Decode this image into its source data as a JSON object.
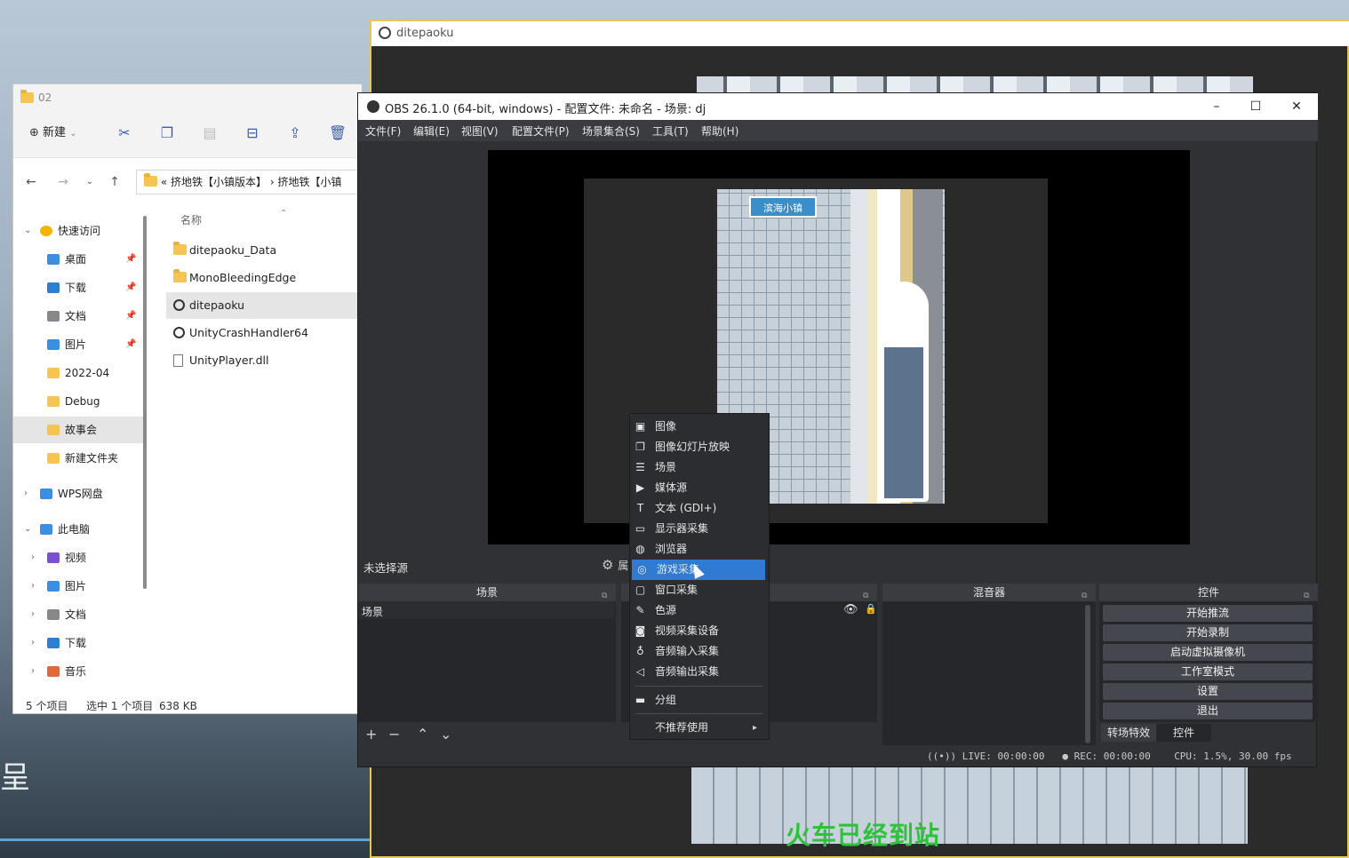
{
  "desktop": {
    "partial_text": "呈"
  },
  "game_window": {
    "title": "ditepaoku",
    "subtitle": "火车已经到站"
  },
  "explorer": {
    "title": "02",
    "toolbar": {
      "new_label": "新建"
    },
    "address": [
      "«",
      "挤地铁【小镇版本】",
      "›",
      "挤地铁【小镇"
    ],
    "sidebar": [
      {
        "label": "快速访问",
        "icon": "star-icon",
        "pinned": false,
        "expander": "⌄"
      },
      {
        "label": "桌面",
        "icon": "desktop-icon",
        "pinned": true
      },
      {
        "label": "下载",
        "icon": "download-icon",
        "pinned": true
      },
      {
        "label": "文档",
        "icon": "document-icon",
        "pinned": true
      },
      {
        "label": "图片",
        "icon": "picture-icon",
        "pinned": true
      },
      {
        "label": "2022-04",
        "icon": "folder-icon",
        "pinned": false
      },
      {
        "label": "Debug",
        "icon": "folder-icon",
        "pinned": false
      },
      {
        "label": "故事会",
        "icon": "folder-icon",
        "pinned": false
      },
      {
        "label": "新建文件夹",
        "icon": "folder-icon",
        "pinned": false
      },
      {
        "label": "WPS网盘",
        "icon": "cloud-icon",
        "pinned": false,
        "expander": "›"
      },
      {
        "label": "此电脑",
        "icon": "computer-icon",
        "pinned": false,
        "expander": "⌄"
      },
      {
        "label": "视频",
        "icon": "video-icon",
        "pinned": false,
        "expander": "›"
      },
      {
        "label": "图片",
        "icon": "picture-icon",
        "pinned": false,
        "expander": "›"
      },
      {
        "label": "文档",
        "icon": "document-icon",
        "pinned": false,
        "expander": "›"
      },
      {
        "label": "下载",
        "icon": "download-icon",
        "pinned": false,
        "expander": "›"
      },
      {
        "label": "音乐",
        "icon": "music-icon",
        "pinned": false,
        "expander": "›"
      }
    ],
    "column_header": "名称",
    "files": [
      {
        "name": "ditepaoku_Data",
        "type": "folder"
      },
      {
        "name": "MonoBleedingEdge",
        "type": "folder"
      },
      {
        "name": "ditepaoku",
        "type": "unity"
      },
      {
        "name": "UnityCrashHandler64",
        "type": "unity"
      },
      {
        "name": "UnityPlayer.dll",
        "type": "dll"
      }
    ],
    "status": {
      "count": "5 个项目",
      "selected": "选中 1 个项目",
      "size": "638 KB"
    }
  },
  "obs": {
    "title": "OBS 26.1.0 (64-bit, windows) - 配置文件: 未命名 - 场景: dj",
    "menu": [
      "文件(F)",
      "编辑(E)",
      "视图(V)",
      "配置文件(P)",
      "场景集合(S)",
      "工具(T)",
      "帮助(H)"
    ],
    "preview": {
      "sign_text": "滨海小镇"
    },
    "no_source": "未选择源",
    "props_label": "属",
    "docks": {
      "scenes": "场景",
      "mixer": "混音器",
      "controls": "控件"
    },
    "scenes": [
      "场景"
    ],
    "controls": [
      "开始推流",
      "开始录制",
      "启动虚拟摄像机",
      "工作室模式",
      "设置",
      "退出"
    ],
    "tabs": [
      "转场特效",
      "控件"
    ],
    "status": {
      "live": "LIVE: 00:00:00",
      "rec": "REC: 00:00:00",
      "cpu": "CPU: 1.5%, 30.00 fps"
    }
  },
  "context_menu": {
    "items": [
      {
        "label": "图像",
        "icon": "image-icon",
        "glyph": "▣"
      },
      {
        "label": "图像幻灯片放映",
        "icon": "slideshow-icon",
        "glyph": "❐"
      },
      {
        "label": "场景",
        "icon": "list-icon",
        "glyph": "☰"
      },
      {
        "label": "媒体源",
        "icon": "play-icon",
        "glyph": "▶"
      },
      {
        "label": "文本 (GDI+)",
        "icon": "text-icon",
        "glyph": "T"
      },
      {
        "label": "显示器采集",
        "icon": "monitor-icon",
        "glyph": "▭"
      },
      {
        "label": "浏览器",
        "icon": "globe-icon",
        "glyph": "◍"
      },
      {
        "label": "游戏采集",
        "icon": "gamepad-icon",
        "glyph": "◎",
        "highlighted": true
      },
      {
        "label": "窗口采集",
        "icon": "window-icon",
        "glyph": "▢"
      },
      {
        "label": "色源",
        "icon": "brush-icon",
        "glyph": "✎"
      },
      {
        "label": "视频采集设备",
        "icon": "camera-icon",
        "glyph": "◙"
      },
      {
        "label": "音频输入采集",
        "icon": "microphone-icon",
        "glyph": "♁"
      },
      {
        "label": "音频输出采集",
        "icon": "speaker-icon",
        "glyph": "◁"
      }
    ],
    "group": {
      "label": "分组",
      "icon": "folder-icon",
      "glyph": "▬"
    },
    "deprecated": {
      "label": "不推荐使用",
      "icon": "submenu-arrow-icon",
      "glyph": "▸"
    }
  }
}
